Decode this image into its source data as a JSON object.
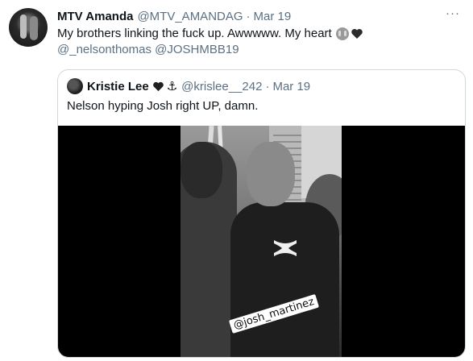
{
  "tweet": {
    "display_name": "MTV Amanda",
    "handle": "@MTV_AMANDAG",
    "separator": "·",
    "date": "Mar 19",
    "more": "···",
    "text": "My brothers linking the fuck up. Awwwww. My heart",
    "mentions": "@_nelsonthomas @JOSHMBB19",
    "emoji_icons": [
      "crying-face-icon",
      "black-heart-icon"
    ]
  },
  "quoted_tweet": {
    "display_name": "Kristie Lee",
    "name_icons": [
      "black-heart-icon",
      "anchor-icon"
    ],
    "anchor_glyph": "⚓",
    "handle": "@krislee__242",
    "separator": "·",
    "date": "Mar 19",
    "text": "Nelson hyping Josh right UP, damn.",
    "media": {
      "type": "video",
      "sticker_text": "@josh_martinez",
      "shirt_logo": "under-armour-logo-icon"
    }
  },
  "colors": {
    "text_primary": "#0f1419",
    "text_secondary": "#5b7083",
    "border": "#cfd9de",
    "background": "#ffffff",
    "media_background": "#000000"
  }
}
